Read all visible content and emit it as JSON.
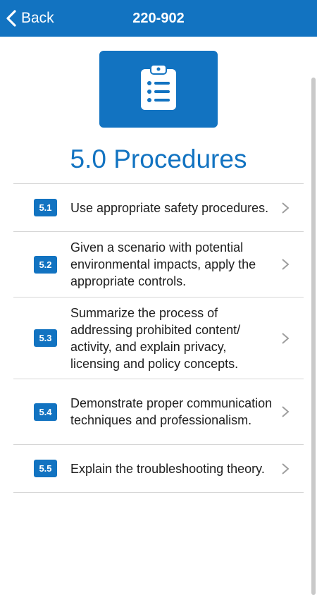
{
  "header": {
    "back_label": "Back",
    "title": "220-902"
  },
  "hero": {
    "icon": "clipboard-list-icon"
  },
  "section": {
    "title": "5.0 Procedures"
  },
  "objectives": [
    {
      "number": "5.1",
      "text": "Use appropriate safety procedures."
    },
    {
      "number": "5.2",
      "text": "Given a scenario with potential environmental impacts, apply the appropriate controls."
    },
    {
      "number": "5.3",
      "text": "Summarize the process of addressing prohibited content/ activity, and explain privacy, licensing and policy concepts."
    },
    {
      "number": "5.4",
      "text": "Demonstrate proper communication techniques and professionalism."
    },
    {
      "number": "5.5",
      "text": "Explain the troubleshooting theory."
    }
  ],
  "colors": {
    "accent": "#1273c1",
    "text": "#1e1e1e",
    "divider": "#d6d6d6",
    "chevron": "#9e9e9e"
  }
}
